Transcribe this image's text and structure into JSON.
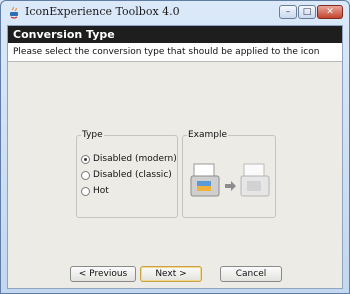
{
  "window": {
    "title": "IconExperience Toolbox 4.0"
  },
  "header": {
    "title": "Conversion Type"
  },
  "description": "Please select the conversion type that should be applied to the icon",
  "type_group": {
    "legend": "Type",
    "options": [
      {
        "label": "Disabled (modern)",
        "selected": true
      },
      {
        "label": "Disabled (classic)",
        "selected": false
      },
      {
        "label": "Hot",
        "selected": false
      }
    ]
  },
  "example_group": {
    "legend": "Example"
  },
  "buttons": {
    "previous": "< Previous",
    "next": "Next >",
    "cancel": "Cancel"
  }
}
